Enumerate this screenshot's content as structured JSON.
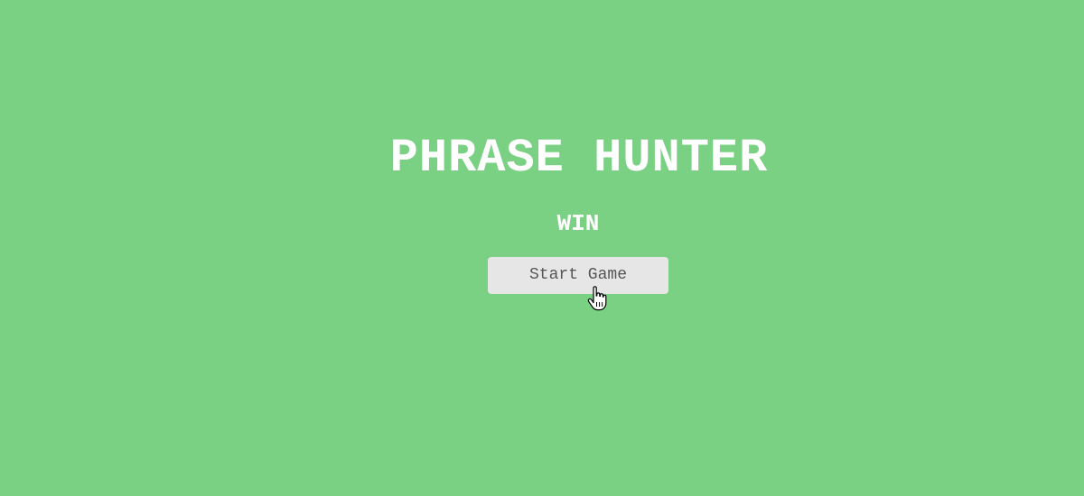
{
  "overlay": {
    "title": "PHRASE HUNTER",
    "message": "WIN",
    "start_button_label": "Start Game"
  },
  "colors": {
    "background": "#7ad083",
    "title_text": "#ffffff",
    "button_background": "#e6e6e6",
    "button_text": "#555555"
  },
  "icons": {
    "cursor": "hand-pointer-icon"
  }
}
